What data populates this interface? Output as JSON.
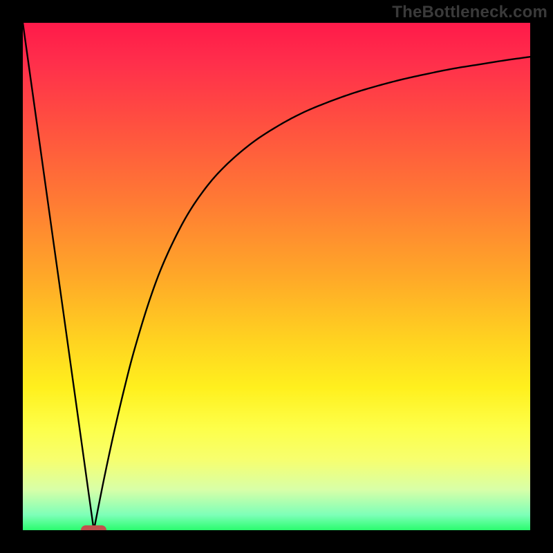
{
  "watermark": "TheBottleneck.com",
  "chart_data": {
    "type": "line",
    "title": "",
    "xlabel": "",
    "ylabel": "",
    "x_range": [
      0,
      100
    ],
    "y_range": [
      0,
      100
    ],
    "grid": false,
    "legend": false,
    "background_gradient": {
      "top_color": "#ff1a4a",
      "bottom_color": "#2afc6e",
      "description": "red at top descending through orange/yellow to green at bottom"
    },
    "series": [
      {
        "name": "left-branch",
        "x": [
          0,
          2,
          4,
          6,
          8,
          10,
          12,
          13,
          14
        ],
        "y": [
          100,
          85.7,
          71.4,
          57.1,
          42.9,
          28.6,
          14.3,
          7.1,
          0
        ]
      },
      {
        "name": "right-branch",
        "x": [
          14,
          16,
          18,
          20,
          22,
          25,
          28,
          32,
          36,
          40,
          45,
          50,
          55,
          60,
          65,
          70,
          75,
          80,
          85,
          90,
          95,
          100
        ],
        "y": [
          0,
          10.1,
          19.4,
          27.9,
          35.6,
          45.4,
          53.3,
          61.4,
          67.4,
          71.9,
          76.2,
          79.5,
          82.2,
          84.3,
          86.1,
          87.6,
          88.9,
          90.0,
          91.0,
          91.8,
          92.6,
          93.3
        ]
      }
    ],
    "minimum_marker": {
      "x": 14,
      "y": 0,
      "width": 5,
      "color": "#c1524d",
      "note": "pill-shaped marker at the curve's minimum on the x-axis"
    }
  }
}
